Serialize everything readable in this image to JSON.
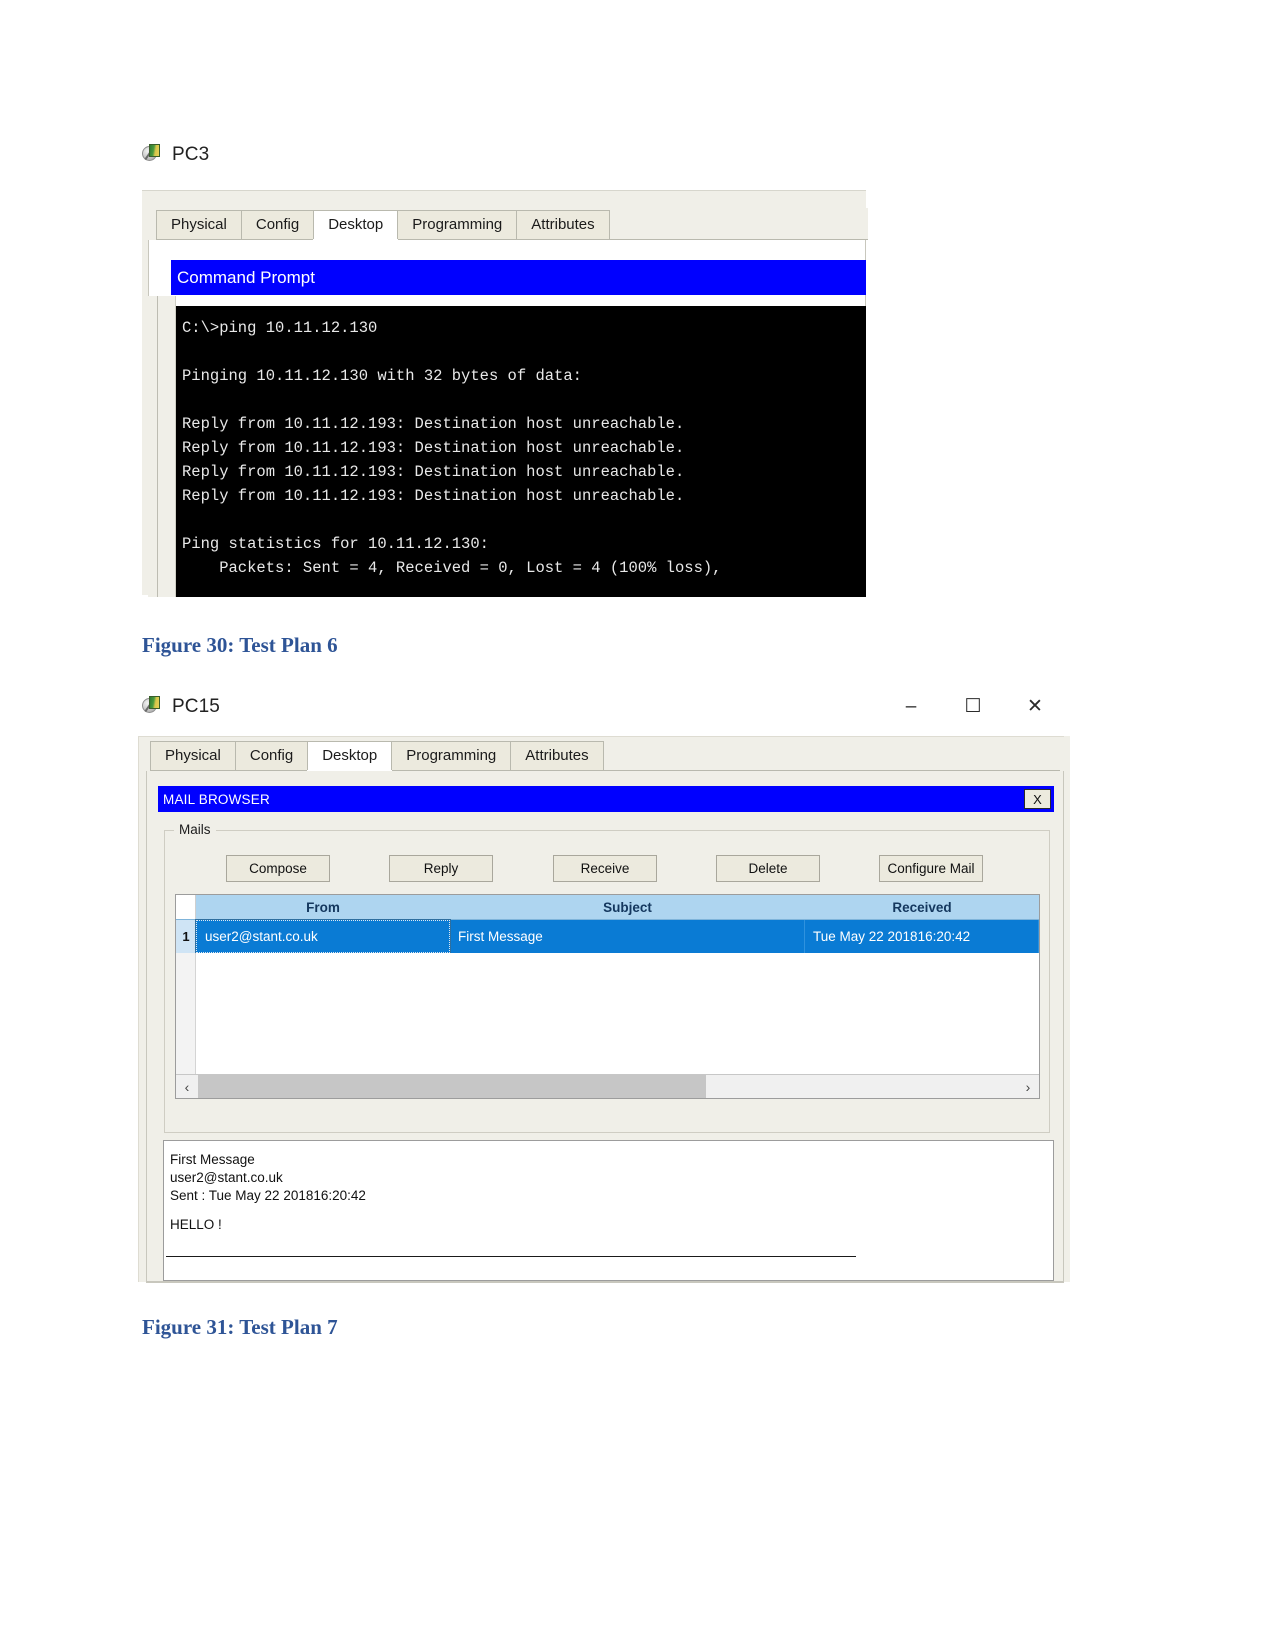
{
  "figure30": {
    "device_title": "PC3",
    "device_icon": "pc-device-icon",
    "tabs": [
      {
        "label": "Physical",
        "active": false
      },
      {
        "label": "Config",
        "active": false
      },
      {
        "label": "Desktop",
        "active": true
      },
      {
        "label": "Programming",
        "active": false
      },
      {
        "label": "Attributes",
        "active": false
      }
    ],
    "app_title": "Command Prompt",
    "console_text": "C:\\>ping 10.11.12.130\n\nPinging 10.11.12.130 with 32 bytes of data:\n\nReply from 10.11.12.193: Destination host unreachable.\nReply from 10.11.12.193: Destination host unreachable.\nReply from 10.11.12.193: Destination host unreachable.\nReply from 10.11.12.193: Destination host unreachable.\n\nPing statistics for 10.11.12.130:\n    Packets: Sent = 4, Received = 0, Lost = 4 (100% loss),",
    "caption": "Figure 30: Test Plan 6"
  },
  "figure31": {
    "device_title": "PC15",
    "device_icon": "pc-device-icon",
    "window_controls": {
      "minimize": "–",
      "maximize": "☐",
      "close": "✕"
    },
    "tabs": [
      {
        "label": "Physical",
        "active": false
      },
      {
        "label": "Config",
        "active": false
      },
      {
        "label": "Desktop",
        "active": true
      },
      {
        "label": "Programming",
        "active": false
      },
      {
        "label": "Attributes",
        "active": false
      }
    ],
    "app_title": "MAIL BROWSER",
    "app_close_label": "X",
    "group_legend": "Mails",
    "toolbar": {
      "compose": "Compose",
      "reply": "Reply",
      "receive": "Receive",
      "delete": "Delete",
      "configure_mail": "Configure Mail"
    },
    "table": {
      "columns": [
        "From",
        "Subject",
        "Received"
      ],
      "rows": [
        {
          "index": "1",
          "from": "user2@stant.co.uk",
          "subject": "First Message",
          "received": "Tue May 22 201816:20:42",
          "selected": true
        }
      ]
    },
    "scrollbar": {
      "left_arrow": "‹",
      "right_arrow": "›"
    },
    "preview": {
      "subject": "First Message",
      "from": "user2@stant.co.uk",
      "sent": "Sent : Tue May 22 201816:20:42",
      "body": "HELLO !"
    },
    "caption": "Figure 31: Test Plan 7"
  },
  "colors": {
    "title_blue": "#0000ff",
    "caption_blue": "#2e5496",
    "row_selected": "#0a7bd4",
    "header_blue": "#aed5f0",
    "console_bg": "#000000"
  }
}
